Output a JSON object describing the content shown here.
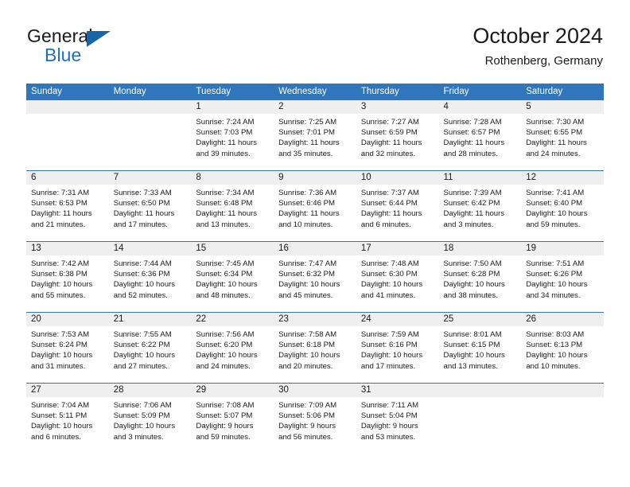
{
  "brand": {
    "line1": "General",
    "line2": "Blue",
    "triangle_icon": "brand-triangle-icon",
    "colors": {
      "blue": "#1f6fc0",
      "triangle": "#1565a8"
    }
  },
  "header": {
    "title": "October 2024",
    "subtitle": "Rothenberg, Germany"
  },
  "theme": {
    "header_blue": "#2f76bc",
    "band_gray": "#efefef",
    "text": "#1a1a1a"
  },
  "weekday_headers": [
    "Sunday",
    "Monday",
    "Tuesday",
    "Wednesday",
    "Thursday",
    "Friday",
    "Saturday"
  ],
  "weeks": [
    [
      {
        "day": "",
        "sunrise": "",
        "sunset": "",
        "daylight1": "",
        "daylight2": ""
      },
      {
        "day": "",
        "sunrise": "",
        "sunset": "",
        "daylight1": "",
        "daylight2": ""
      },
      {
        "day": "1",
        "sunrise": "Sunrise: 7:24 AM",
        "sunset": "Sunset: 7:03 PM",
        "daylight1": "Daylight: 11 hours",
        "daylight2": "and 39 minutes."
      },
      {
        "day": "2",
        "sunrise": "Sunrise: 7:25 AM",
        "sunset": "Sunset: 7:01 PM",
        "daylight1": "Daylight: 11 hours",
        "daylight2": "and 35 minutes."
      },
      {
        "day": "3",
        "sunrise": "Sunrise: 7:27 AM",
        "sunset": "Sunset: 6:59 PM",
        "daylight1": "Daylight: 11 hours",
        "daylight2": "and 32 minutes."
      },
      {
        "day": "4",
        "sunrise": "Sunrise: 7:28 AM",
        "sunset": "Sunset: 6:57 PM",
        "daylight1": "Daylight: 11 hours",
        "daylight2": "and 28 minutes."
      },
      {
        "day": "5",
        "sunrise": "Sunrise: 7:30 AM",
        "sunset": "Sunset: 6:55 PM",
        "daylight1": "Daylight: 11 hours",
        "daylight2": "and 24 minutes."
      }
    ],
    [
      {
        "day": "6",
        "sunrise": "Sunrise: 7:31 AM",
        "sunset": "Sunset: 6:53 PM",
        "daylight1": "Daylight: 11 hours",
        "daylight2": "and 21 minutes."
      },
      {
        "day": "7",
        "sunrise": "Sunrise: 7:33 AM",
        "sunset": "Sunset: 6:50 PM",
        "daylight1": "Daylight: 11 hours",
        "daylight2": "and 17 minutes."
      },
      {
        "day": "8",
        "sunrise": "Sunrise: 7:34 AM",
        "sunset": "Sunset: 6:48 PM",
        "daylight1": "Daylight: 11 hours",
        "daylight2": "and 13 minutes."
      },
      {
        "day": "9",
        "sunrise": "Sunrise: 7:36 AM",
        "sunset": "Sunset: 6:46 PM",
        "daylight1": "Daylight: 11 hours",
        "daylight2": "and 10 minutes."
      },
      {
        "day": "10",
        "sunrise": "Sunrise: 7:37 AM",
        "sunset": "Sunset: 6:44 PM",
        "daylight1": "Daylight: 11 hours",
        "daylight2": "and 6 minutes."
      },
      {
        "day": "11",
        "sunrise": "Sunrise: 7:39 AM",
        "sunset": "Sunset: 6:42 PM",
        "daylight1": "Daylight: 11 hours",
        "daylight2": "and 3 minutes."
      },
      {
        "day": "12",
        "sunrise": "Sunrise: 7:41 AM",
        "sunset": "Sunset: 6:40 PM",
        "daylight1": "Daylight: 10 hours",
        "daylight2": "and 59 minutes."
      }
    ],
    [
      {
        "day": "13",
        "sunrise": "Sunrise: 7:42 AM",
        "sunset": "Sunset: 6:38 PM",
        "daylight1": "Daylight: 10 hours",
        "daylight2": "and 55 minutes."
      },
      {
        "day": "14",
        "sunrise": "Sunrise: 7:44 AM",
        "sunset": "Sunset: 6:36 PM",
        "daylight1": "Daylight: 10 hours",
        "daylight2": "and 52 minutes."
      },
      {
        "day": "15",
        "sunrise": "Sunrise: 7:45 AM",
        "sunset": "Sunset: 6:34 PM",
        "daylight1": "Daylight: 10 hours",
        "daylight2": "and 48 minutes."
      },
      {
        "day": "16",
        "sunrise": "Sunrise: 7:47 AM",
        "sunset": "Sunset: 6:32 PM",
        "daylight1": "Daylight: 10 hours",
        "daylight2": "and 45 minutes."
      },
      {
        "day": "17",
        "sunrise": "Sunrise: 7:48 AM",
        "sunset": "Sunset: 6:30 PM",
        "daylight1": "Daylight: 10 hours",
        "daylight2": "and 41 minutes."
      },
      {
        "day": "18",
        "sunrise": "Sunrise: 7:50 AM",
        "sunset": "Sunset: 6:28 PM",
        "daylight1": "Daylight: 10 hours",
        "daylight2": "and 38 minutes."
      },
      {
        "day": "19",
        "sunrise": "Sunrise: 7:51 AM",
        "sunset": "Sunset: 6:26 PM",
        "daylight1": "Daylight: 10 hours",
        "daylight2": "and 34 minutes."
      }
    ],
    [
      {
        "day": "20",
        "sunrise": "Sunrise: 7:53 AM",
        "sunset": "Sunset: 6:24 PM",
        "daylight1": "Daylight: 10 hours",
        "daylight2": "and 31 minutes."
      },
      {
        "day": "21",
        "sunrise": "Sunrise: 7:55 AM",
        "sunset": "Sunset: 6:22 PM",
        "daylight1": "Daylight: 10 hours",
        "daylight2": "and 27 minutes."
      },
      {
        "day": "22",
        "sunrise": "Sunrise: 7:56 AM",
        "sunset": "Sunset: 6:20 PM",
        "daylight1": "Daylight: 10 hours",
        "daylight2": "and 24 minutes."
      },
      {
        "day": "23",
        "sunrise": "Sunrise: 7:58 AM",
        "sunset": "Sunset: 6:18 PM",
        "daylight1": "Daylight: 10 hours",
        "daylight2": "and 20 minutes."
      },
      {
        "day": "24",
        "sunrise": "Sunrise: 7:59 AM",
        "sunset": "Sunset: 6:16 PM",
        "daylight1": "Daylight: 10 hours",
        "daylight2": "and 17 minutes."
      },
      {
        "day": "25",
        "sunrise": "Sunrise: 8:01 AM",
        "sunset": "Sunset: 6:15 PM",
        "daylight1": "Daylight: 10 hours",
        "daylight2": "and 13 minutes."
      },
      {
        "day": "26",
        "sunrise": "Sunrise: 8:03 AM",
        "sunset": "Sunset: 6:13 PM",
        "daylight1": "Daylight: 10 hours",
        "daylight2": "and 10 minutes."
      }
    ],
    [
      {
        "day": "27",
        "sunrise": "Sunrise: 7:04 AM",
        "sunset": "Sunset: 5:11 PM",
        "daylight1": "Daylight: 10 hours",
        "daylight2": "and 6 minutes."
      },
      {
        "day": "28",
        "sunrise": "Sunrise: 7:06 AM",
        "sunset": "Sunset: 5:09 PM",
        "daylight1": "Daylight: 10 hours",
        "daylight2": "and 3 minutes."
      },
      {
        "day": "29",
        "sunrise": "Sunrise: 7:08 AM",
        "sunset": "Sunset: 5:07 PM",
        "daylight1": "Daylight: 9 hours",
        "daylight2": "and 59 minutes."
      },
      {
        "day": "30",
        "sunrise": "Sunrise: 7:09 AM",
        "sunset": "Sunset: 5:06 PM",
        "daylight1": "Daylight: 9 hours",
        "daylight2": "and 56 minutes."
      },
      {
        "day": "31",
        "sunrise": "Sunrise: 7:11 AM",
        "sunset": "Sunset: 5:04 PM",
        "daylight1": "Daylight: 9 hours",
        "daylight2": "and 53 minutes."
      },
      {
        "day": "",
        "sunrise": "",
        "sunset": "",
        "daylight1": "",
        "daylight2": ""
      },
      {
        "day": "",
        "sunrise": "",
        "sunset": "",
        "daylight1": "",
        "daylight2": ""
      }
    ]
  ]
}
